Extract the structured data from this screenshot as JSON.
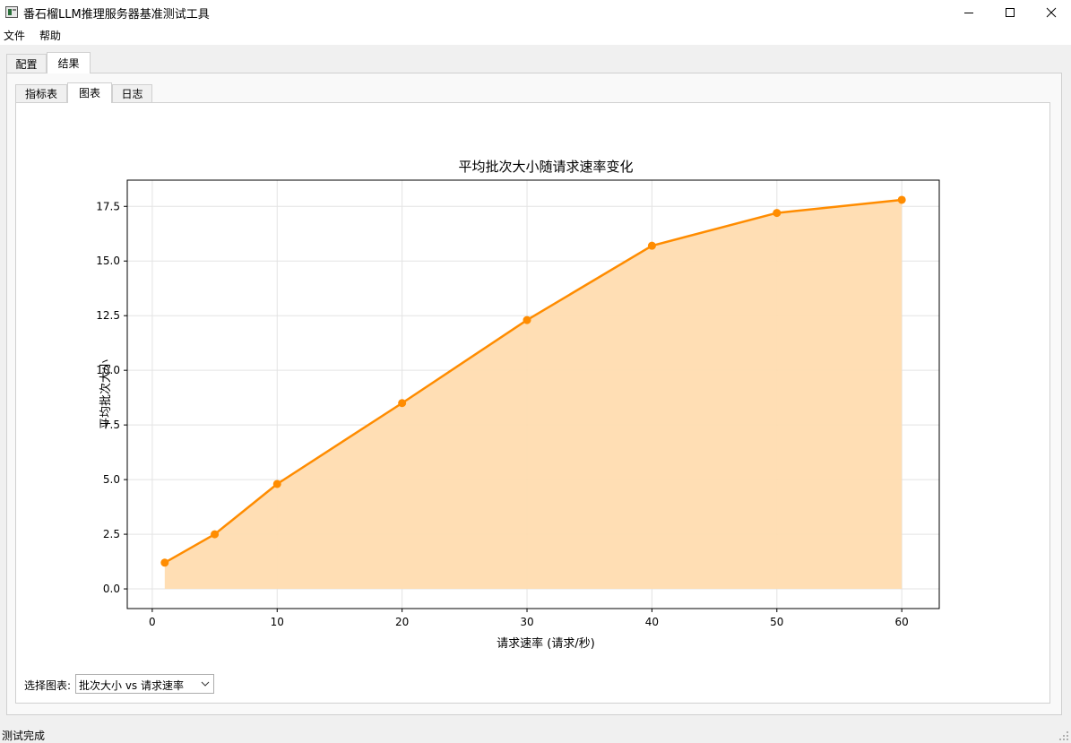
{
  "window": {
    "title": "番石榴LLM推理服务器基准测试工具"
  },
  "menu": [
    "文件",
    "帮助"
  ],
  "main_tabs": [
    {
      "label": "配置",
      "active": false
    },
    {
      "label": "结果",
      "active": true
    }
  ],
  "sub_tabs": [
    {
      "label": "指标表",
      "active": false
    },
    {
      "label": "图表",
      "active": true
    },
    {
      "label": "日志",
      "active": false
    }
  ],
  "chart_data": {
    "type": "area",
    "title": "平均批次大小随请求速率变化",
    "xlabel": "请求速率 (请求/秒)",
    "ylabel": "平均批次大小",
    "x": [
      1,
      5,
      10,
      20,
      30,
      40,
      50,
      60
    ],
    "series": [
      {
        "values": [
          1.2,
          2.5,
          4.8,
          8.5,
          12.3,
          15.7,
          17.2,
          17.8
        ]
      }
    ],
    "xlim": [
      -2,
      63
    ],
    "ylim": [
      -0.9,
      18.7
    ],
    "xticks": [
      0,
      10,
      20,
      30,
      40,
      50,
      60
    ],
    "yticks": [
      0.0,
      2.5,
      5.0,
      7.5,
      10.0,
      12.5,
      15.0,
      17.5
    ],
    "ytick_labels": [
      "0.0",
      "2.5",
      "5.0",
      "7.5",
      "10.0",
      "12.5",
      "15.0",
      "17.5"
    ],
    "grid": true,
    "colors": {
      "line": "#ff8c00",
      "fill": "#ffdcb0"
    }
  },
  "chart_selector": {
    "label": "选择图表:",
    "selected": "批次大小 vs 请求速率"
  },
  "status": "测试完成"
}
